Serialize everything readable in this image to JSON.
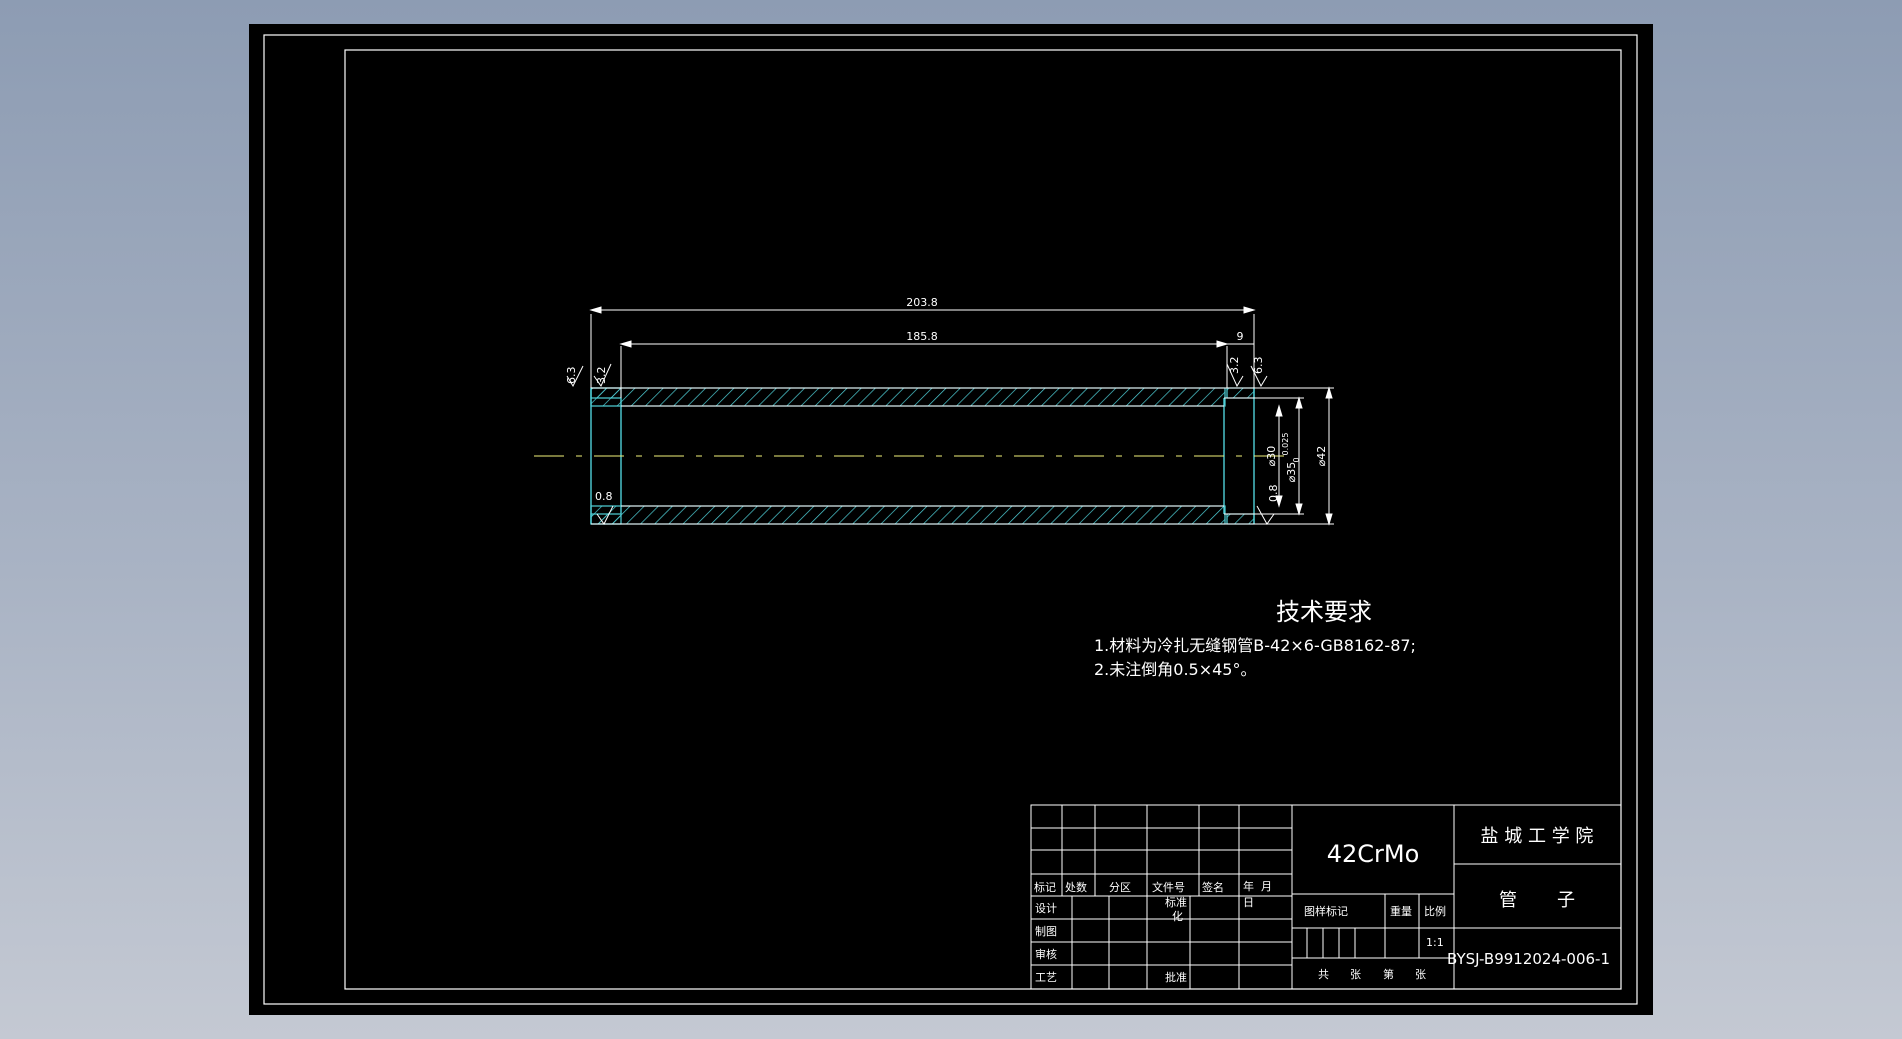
{
  "colors": {
    "background": "#000000",
    "line": "#ffffff",
    "section": "#4fd1d9",
    "centerline": "#f2f27a"
  },
  "dimensions": {
    "overall_length": "203.8",
    "inner_length": "185.8",
    "end_length": "9",
    "bore_dia": "⌀30",
    "counterbore_dia": "⌀35",
    "counterbore_tol": "0.025",
    "counterbore_tol_low": "0",
    "outer_dia": "⌀42",
    "rough_left_outer": "6.3",
    "rough_left_inner": "3.2",
    "rough_right_inner": "3.2",
    "rough_right_outer": "6.3",
    "rough_left_bore": "0.8",
    "rough_right_bore": "0.8"
  },
  "tech_req": {
    "title": "技术要求",
    "line1": "1.材料为冷扎无缝钢管B-42×6-GB8162-87;",
    "line2": "2.未注倒角0.5×45°。"
  },
  "title_block": {
    "material": "42CrMo",
    "school": "盐 城 工 学 院",
    "part_name": "管       子",
    "drawing_no": "BYSJ-B9912024-006-1",
    "scale": "1:1",
    "hdr_biaoji": "标记",
    "hdr_chushu": "处数",
    "hdr_fenqu": "分区",
    "hdr_wenjian": "文件号",
    "hdr_qianming": "签名",
    "hdr_nian": "年",
    "hdr_yue": "月",
    "hdr_ri": "日",
    "sheji": "设计",
    "zhitu": "制图",
    "shenhe": "审核",
    "gongyi": "工艺",
    "biaozhunhua_1": "标准",
    "biaozhunhua_2": "化",
    "pizhun": "批准",
    "tuyang_biaoji": "图样标记",
    "zhongliang": "重量",
    "bili": "比例",
    "gong": "共",
    "zhang1": "张",
    "di": "第",
    "zhang2": "张"
  }
}
